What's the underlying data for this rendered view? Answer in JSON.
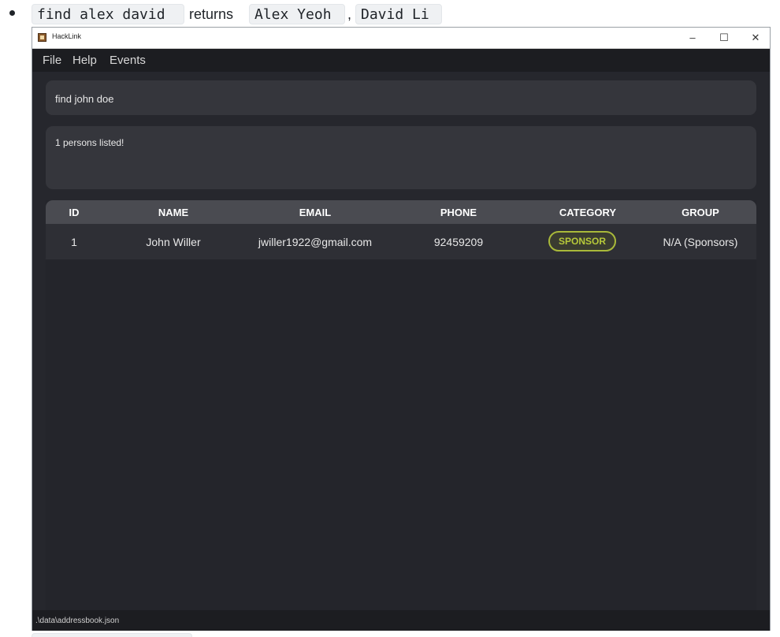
{
  "doc": {
    "command": "find alex david",
    "returns_word": "returns",
    "result_1": "Alex Yeoh",
    "comma": ",",
    "result_2": "David Li"
  },
  "window": {
    "title": "HackLink",
    "minimize": "–",
    "maximize": "☐",
    "close": "✕"
  },
  "menu": {
    "items": [
      "File",
      "Help",
      "Events"
    ]
  },
  "command_box": {
    "value": "find john doe"
  },
  "result_display": {
    "text": "1 persons listed!"
  },
  "table": {
    "columns": [
      "ID",
      "NAME",
      "EMAIL",
      "PHONE",
      "CATEGORY",
      "GROUP"
    ],
    "rows": [
      {
        "id": "1",
        "name": "John Willer",
        "email": "jwiller1922@gmail.com",
        "phone": "92459209",
        "category": "SPONSOR",
        "group": "N/A (Sponsors)"
      }
    ]
  },
  "status_bar": {
    "path": ".\\data\\addressbook.json"
  },
  "colors": {
    "background": "#26272d",
    "sponsor_badge": "#b7c93a"
  }
}
